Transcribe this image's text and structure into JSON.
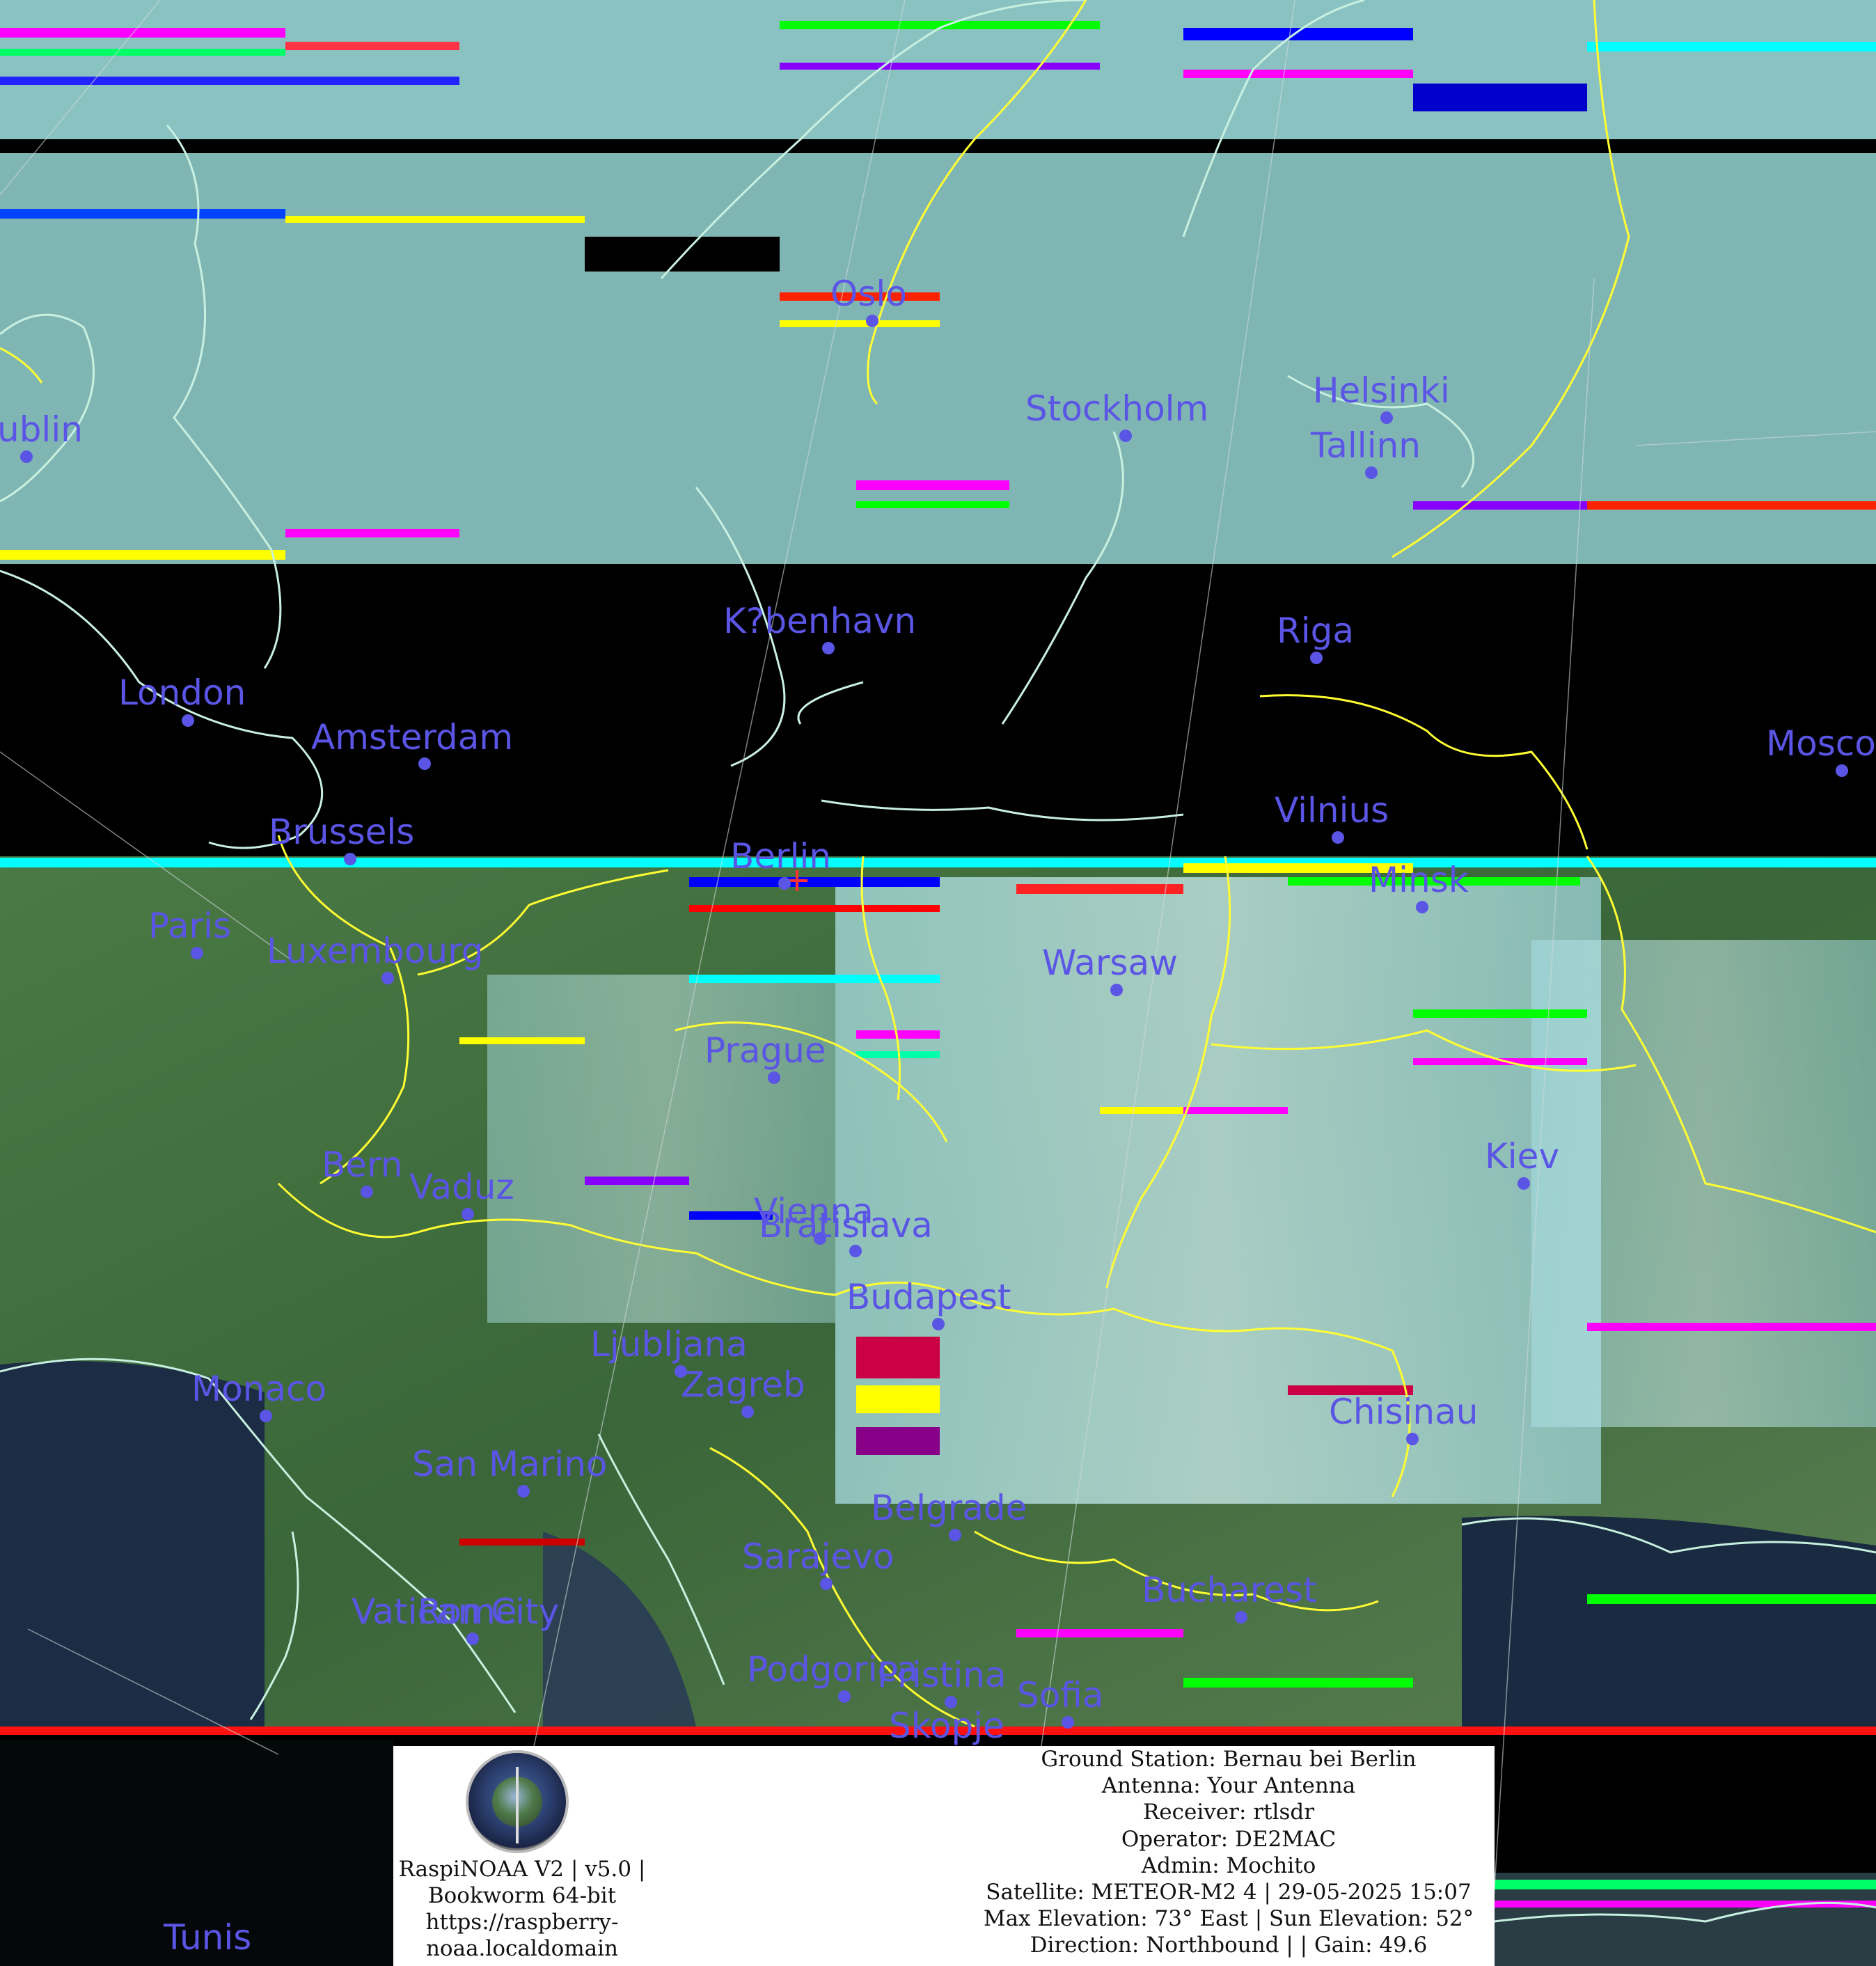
{
  "colors": {
    "label": "#5b55e6",
    "border": "#ffff33",
    "coast": "#c8f0e0",
    "cloud": "#b8e8ea",
    "land": "#3c6b3c",
    "sea": "#1a2a3e"
  },
  "cities": [
    {
      "name": "ublin"
    },
    {
      "name": "London"
    },
    {
      "name": "Amsterdam"
    },
    {
      "name": "Brussels"
    },
    {
      "name": "Paris"
    },
    {
      "name": "Luxembourg"
    },
    {
      "name": "Bern"
    },
    {
      "name": "Vaduz"
    },
    {
      "name": "Monaco"
    },
    {
      "name": "San Marino"
    },
    {
      "name": "Vatican City"
    },
    {
      "name": "Rome"
    },
    {
      "name": "Oslo"
    },
    {
      "name": "Stockholm"
    },
    {
      "name": "Helsinki"
    },
    {
      "name": "Tallinn"
    },
    {
      "name": "K?benhavn"
    },
    {
      "name": "Riga"
    },
    {
      "name": "Mosco"
    },
    {
      "name": "Vilnius"
    },
    {
      "name": "Berlin"
    },
    {
      "name": "Minsk"
    },
    {
      "name": "Warsaw"
    },
    {
      "name": "Prague"
    },
    {
      "name": "Kiev"
    },
    {
      "name": "Vienna"
    },
    {
      "name": "Bratislava"
    },
    {
      "name": "Budapest"
    },
    {
      "name": "Ljubljana"
    },
    {
      "name": "Zagreb"
    },
    {
      "name": "Chisinau"
    },
    {
      "name": "Belgrade"
    },
    {
      "name": "Sarajevo"
    },
    {
      "name": "Bucharest"
    },
    {
      "name": "Podgorica"
    },
    {
      "name": "Pristina"
    },
    {
      "name": "Sofia"
    },
    {
      "name": "Skopje"
    },
    {
      "name": "Tunis"
    }
  ],
  "info": {
    "left_lines": [
      "RaspiNOAA V2 | v5.0 |",
      "Bookworm 64-bit",
      "https://raspberry-",
      "noaa.localdomain"
    ],
    "right_lines": [
      "Ground Station: Bernau bei Berlin",
      "Antenna: Your Antenna",
      "Receiver: rtlsdr",
      "Operator: DE2MAC",
      "Admin: Mochito",
      "Satellite: METEOR-M2 4 | 29-05-2025 15:07",
      "Max Elevation: 73° East | Sun Elevation: 52°",
      "Direction: Northbound | | Gain: 49.6"
    ]
  }
}
